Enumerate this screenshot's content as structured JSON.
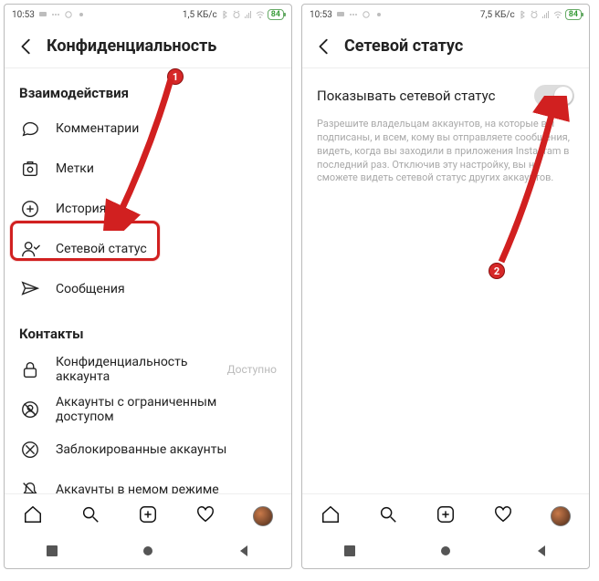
{
  "left": {
    "status": {
      "time": "10:53",
      "net": "1,5 КБ/с",
      "battery": "84"
    },
    "header": {
      "title": "Конфиденциальность"
    },
    "section1": {
      "title": "Взаимодействия"
    },
    "rows1": {
      "comments": "Комментарии",
      "tags": "Метки",
      "story": "История",
      "activity": "Сетевой статус",
      "messages": "Сообщения"
    },
    "section2": {
      "title": "Контакты"
    },
    "rows2": {
      "privacy": "Конфиденциальность аккаунта",
      "privacy_aux": "Доступно",
      "restricted": "Аккаунты с ограниченным доступом",
      "blocked": "Заблокированные аккаунты",
      "muted": "Аккаунты в немом режиме"
    },
    "badge": "1"
  },
  "right": {
    "status": {
      "time": "10:53",
      "net": "7,5 КБ/с",
      "battery": "84"
    },
    "header": {
      "title": "Сетевой статус"
    },
    "toggle_label": "Показывать сетевой статус",
    "desc": "Разрешите владельцам аккаунтов, на которые вы подписаны, и всем, кому вы отправляете сообщения, видеть, когда вы заходили в приложения Instagram в последний раз. Отключив эту настройку, вы не сможете видеть сетевой статус других аккаунтов.",
    "badge": "2"
  }
}
